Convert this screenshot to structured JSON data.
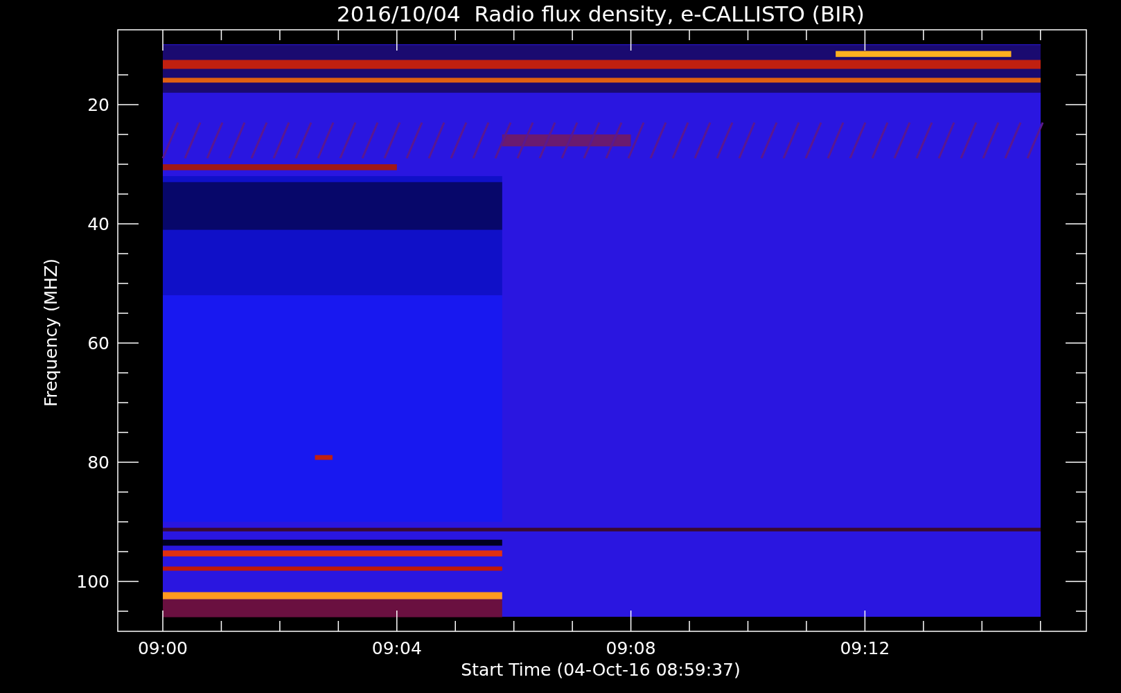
{
  "title": "2016/10/04  Radio flux density, e-CALLISTO (BIR)",
  "y_axis": {
    "label": "Frequency (MHZ)",
    "ticks": [
      "20",
      "40",
      "60",
      "80",
      "100"
    ]
  },
  "x_axis": {
    "label": "Start Time (04-Oct-16 08:59:37)",
    "ticks": [
      "09:00",
      "09:04",
      "09:08",
      "09:12"
    ]
  }
}
